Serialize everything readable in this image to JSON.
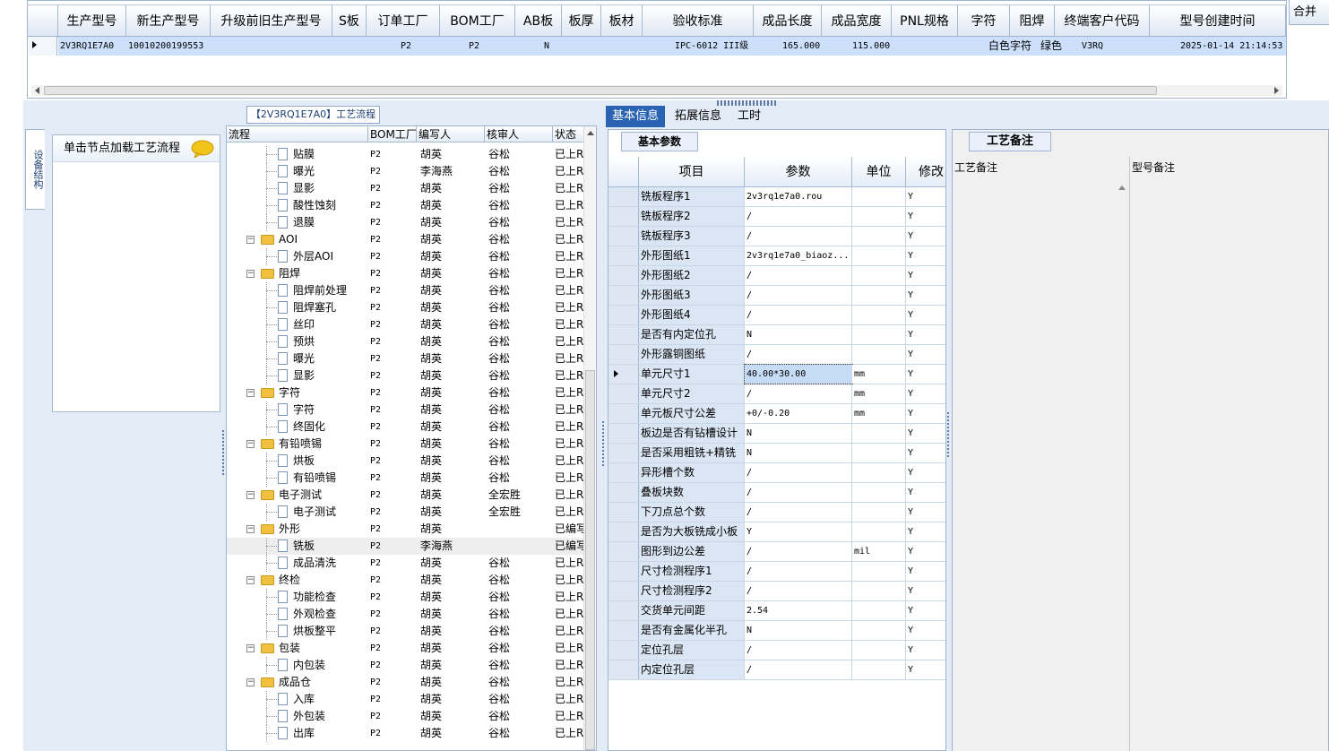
{
  "top_grid": {
    "headers": [
      "生产型号",
      "新生产型号",
      "升级前旧生产型号",
      "S板",
      "订单工厂",
      "BOM工厂",
      "AB板",
      "板厚",
      "板材",
      "验收标准",
      "成品长度",
      "成品宽度",
      "PNL规格",
      "字符",
      "阻焊",
      "终端客户代码",
      "型号创建时间"
    ],
    "row": {
      "model": "2V3RQ1E7A0",
      "new_model": "10010200199553",
      "old_model": "",
      "s_board": "",
      "order_factory": "P2",
      "bom_factory": "P2",
      "ab_board": "N",
      "thickness": "",
      "material": "",
      "standard": "IPC-6012 III级",
      "length": "165.000",
      "width": "115.000",
      "pnl": "",
      "character": "白色字符",
      "solder_mask": "绿色",
      "customer_code": "V3RQ",
      "created_at": "2025-01-14 21:14:53"
    },
    "mini_header": "合并"
  },
  "left_panel": {
    "vertical_tab": "设备结构",
    "card_hint": "单击节点加载工艺流程"
  },
  "process_panel": {
    "title": "【2V3RQ1E7A0】工艺流程",
    "headers": [
      "流程",
      "BOM工厂",
      "编写人",
      "核审人",
      "状态"
    ],
    "rows": [
      {
        "name": "贴膜",
        "level": 2,
        "factory": "P2",
        "writer": "胡英",
        "reviewer": "谷松",
        "status": "已上R"
      },
      {
        "name": "曝光",
        "level": 2,
        "factory": "P2",
        "writer": "李海燕",
        "reviewer": "谷松",
        "status": "已上R"
      },
      {
        "name": "显影",
        "level": 2,
        "factory": "P2",
        "writer": "胡英",
        "reviewer": "谷松",
        "status": "已上R"
      },
      {
        "name": "酸性蚀刻",
        "level": 2,
        "factory": "P2",
        "writer": "胡英",
        "reviewer": "谷松",
        "status": "已上R"
      },
      {
        "name": "退膜",
        "level": 2,
        "factory": "P2",
        "writer": "胡英",
        "reviewer": "谷松",
        "status": "已上R"
      },
      {
        "name": "AOI",
        "level": 1,
        "factory": "P2",
        "writer": "胡英",
        "reviewer": "谷松",
        "status": "已上R"
      },
      {
        "name": "外层AOI",
        "level": 2,
        "factory": "P2",
        "writer": "胡英",
        "reviewer": "谷松",
        "status": "已上R"
      },
      {
        "name": "阻焊",
        "level": 1,
        "factory": "P2",
        "writer": "胡英",
        "reviewer": "谷松",
        "status": "已上R"
      },
      {
        "name": "阻焊前处理",
        "level": 2,
        "factory": "P2",
        "writer": "胡英",
        "reviewer": "谷松",
        "status": "已上R"
      },
      {
        "name": "阻焊塞孔",
        "level": 2,
        "factory": "P2",
        "writer": "胡英",
        "reviewer": "谷松",
        "status": "已上R"
      },
      {
        "name": "丝印",
        "level": 2,
        "factory": "P2",
        "writer": "胡英",
        "reviewer": "谷松",
        "status": "已上R"
      },
      {
        "name": "预烘",
        "level": 2,
        "factory": "P2",
        "writer": "胡英",
        "reviewer": "谷松",
        "status": "已上R"
      },
      {
        "name": "曝光",
        "level": 2,
        "factory": "P2",
        "writer": "胡英",
        "reviewer": "谷松",
        "status": "已上R"
      },
      {
        "name": "显影",
        "level": 2,
        "factory": "P2",
        "writer": "胡英",
        "reviewer": "谷松",
        "status": "已上R"
      },
      {
        "name": "字符",
        "level": 1,
        "factory": "P2",
        "writer": "胡英",
        "reviewer": "谷松",
        "status": "已上R"
      },
      {
        "name": "字符",
        "level": 2,
        "factory": "P2",
        "writer": "胡英",
        "reviewer": "谷松",
        "status": "已上R"
      },
      {
        "name": "终固化",
        "level": 2,
        "factory": "P2",
        "writer": "胡英",
        "reviewer": "谷松",
        "status": "已上R"
      },
      {
        "name": "有铅喷锡",
        "level": 1,
        "factory": "P2",
        "writer": "胡英",
        "reviewer": "谷松",
        "status": "已上R"
      },
      {
        "name": "烘板",
        "level": 2,
        "factory": "P2",
        "writer": "胡英",
        "reviewer": "谷松",
        "status": "已上R"
      },
      {
        "name": "有铅喷锡",
        "level": 2,
        "factory": "P2",
        "writer": "胡英",
        "reviewer": "谷松",
        "status": "已上R"
      },
      {
        "name": "电子测试",
        "level": 1,
        "factory": "P2",
        "writer": "胡英",
        "reviewer": "全宏胜",
        "status": "已上R"
      },
      {
        "name": "电子测试",
        "level": 2,
        "factory": "P2",
        "writer": "胡英",
        "reviewer": "全宏胜",
        "status": "已上R"
      },
      {
        "name": "外形",
        "level": 1,
        "factory": "P2",
        "writer": "胡英",
        "reviewer": "",
        "status": "已编写"
      },
      {
        "name": "铣板",
        "level": 2,
        "factory": "P2",
        "writer": "李海燕",
        "reviewer": "",
        "status": "已编写"
      },
      {
        "name": "成品清洗",
        "level": 2,
        "factory": "P2",
        "writer": "胡英",
        "reviewer": "谷松",
        "status": "已上R"
      },
      {
        "name": "终检",
        "level": 1,
        "factory": "P2",
        "writer": "胡英",
        "reviewer": "谷松",
        "status": "已上R"
      },
      {
        "name": "功能检查",
        "level": 2,
        "factory": "P2",
        "writer": "胡英",
        "reviewer": "谷松",
        "status": "已上R"
      },
      {
        "name": "外观检查",
        "level": 2,
        "factory": "P2",
        "writer": "胡英",
        "reviewer": "谷松",
        "status": "已上R"
      },
      {
        "name": "烘板整平",
        "level": 2,
        "factory": "P2",
        "writer": "胡英",
        "reviewer": "谷松",
        "status": "已上R"
      },
      {
        "name": "包装",
        "level": 1,
        "factory": "P2",
        "writer": "胡英",
        "reviewer": "谷松",
        "status": "已上R"
      },
      {
        "name": "内包装",
        "level": 2,
        "factory": "P2",
        "writer": "胡英",
        "reviewer": "谷松",
        "status": "已上R"
      },
      {
        "name": "成品仓",
        "level": 1,
        "factory": "P2",
        "writer": "胡英",
        "reviewer": "谷松",
        "status": "已上R"
      },
      {
        "name": "入库",
        "level": 2,
        "factory": "P2",
        "writer": "胡英",
        "reviewer": "谷松",
        "status": "已上R"
      },
      {
        "name": "外包装",
        "level": 2,
        "factory": "P2",
        "writer": "胡英",
        "reviewer": "谷松",
        "status": "已上R"
      },
      {
        "name": "出库",
        "level": 2,
        "factory": "P2",
        "writer": "胡英",
        "reviewer": "谷松",
        "status": "已上R"
      }
    ]
  },
  "right_tabs": [
    "基本信息",
    "拓展信息",
    "工时"
  ],
  "basic_params": {
    "tab": "基本参数",
    "headers": [
      "项目",
      "参数",
      "单位",
      "修改"
    ],
    "rows": [
      {
        "item": "铣板程序1",
        "param": "2v3rq1e7a0.rou",
        "unit": "",
        "mod": "Y"
      },
      {
        "item": "铣板程序2",
        "param": "/",
        "unit": "",
        "mod": "Y"
      },
      {
        "item": "铣板程序3",
        "param": "/",
        "unit": "",
        "mod": "Y"
      },
      {
        "item": "外形图纸1",
        "param": "2v3rq1e7a0_biaoz...",
        "unit": "",
        "mod": "Y"
      },
      {
        "item": "外形图纸2",
        "param": "/",
        "unit": "",
        "mod": "Y"
      },
      {
        "item": "外形图纸3",
        "param": "/",
        "unit": "",
        "mod": "Y"
      },
      {
        "item": "外形图纸4",
        "param": "/",
        "unit": "",
        "mod": "Y"
      },
      {
        "item": "是否有内定位孔",
        "param": "N",
        "unit": "",
        "mod": "Y"
      },
      {
        "item": "外形露铜图纸",
        "param": "/",
        "unit": "",
        "mod": "Y"
      },
      {
        "item": "单元尺寸1",
        "param": "40.00*30.00",
        "unit": "mm",
        "mod": "Y"
      },
      {
        "item": "单元尺寸2",
        "param": "/",
        "unit": "mm",
        "mod": "Y"
      },
      {
        "item": "单元板尺寸公差",
        "param": "+0/-0.20",
        "unit": "mm",
        "mod": "Y"
      },
      {
        "item": "板边是否有钻槽设计",
        "param": "N",
        "unit": "",
        "mod": "Y"
      },
      {
        "item": "是否采用粗铣+精铣",
        "param": "N",
        "unit": "",
        "mod": "Y"
      },
      {
        "item": "异形槽个数",
        "param": "/",
        "unit": "",
        "mod": "Y"
      },
      {
        "item": "叠板块数",
        "param": "/",
        "unit": "",
        "mod": "Y"
      },
      {
        "item": "下刀点总个数",
        "param": "/",
        "unit": "",
        "mod": "Y"
      },
      {
        "item": "是否为大板铣成小板",
        "param": "Y",
        "unit": "",
        "mod": "Y"
      },
      {
        "item": "图形到边公差",
        "param": "/",
        "unit": "mil",
        "mod": "Y"
      },
      {
        "item": "尺寸检测程序1",
        "param": "/",
        "unit": "",
        "mod": "Y"
      },
      {
        "item": "尺寸检测程序2",
        "param": "/",
        "unit": "",
        "mod": "Y"
      },
      {
        "item": "交货单元间距",
        "param": "2.54",
        "unit": "",
        "mod": "Y"
      },
      {
        "item": "是否有金属化半孔",
        "param": "N",
        "unit": "",
        "mod": "Y"
      },
      {
        "item": "定位孔层",
        "param": "/",
        "unit": "",
        "mod": "Y"
      },
      {
        "item": "内定位孔层",
        "param": "/",
        "unit": "",
        "mod": "Y"
      }
    ]
  },
  "remarks": {
    "tab": "工艺备注",
    "col1": "工艺备注",
    "col2": "型号备注"
  },
  "colors": {
    "accent": "#2b63b3",
    "selected_row": "#cce0fb",
    "panel_bg": "#e2ebf6",
    "folder": "#f1c040"
  }
}
